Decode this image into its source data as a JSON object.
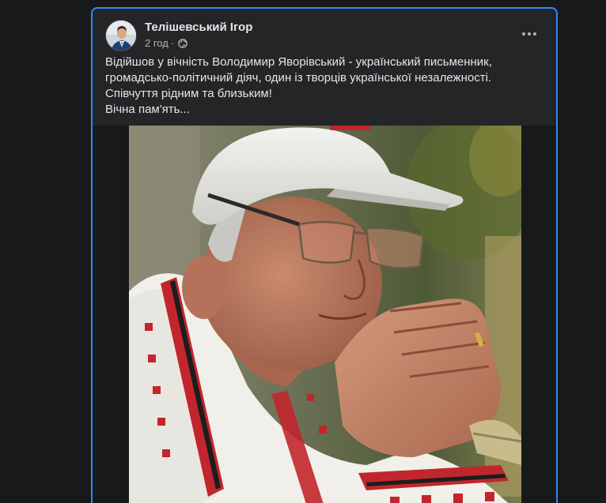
{
  "post": {
    "author": "Телішевський Ігор",
    "time": "2 год",
    "separator": "·",
    "privacy_icon": "globe-icon",
    "more_icon": "more-options-icon",
    "text_lines": [
      "Відійшов у вічність Володимир Яворівський - український письменник,",
      "громадсько-політичний діяч, один із творців української незалежності.",
      "Співчуття рідним та близьким!",
      "Вічна пам'ять..."
    ]
  },
  "colors": {
    "card_background": "#242526",
    "card_border": "#2d88ff",
    "page_background": "#18191a",
    "primary_text": "#e4e6eb",
    "secondary_text": "#b0b3b8"
  }
}
